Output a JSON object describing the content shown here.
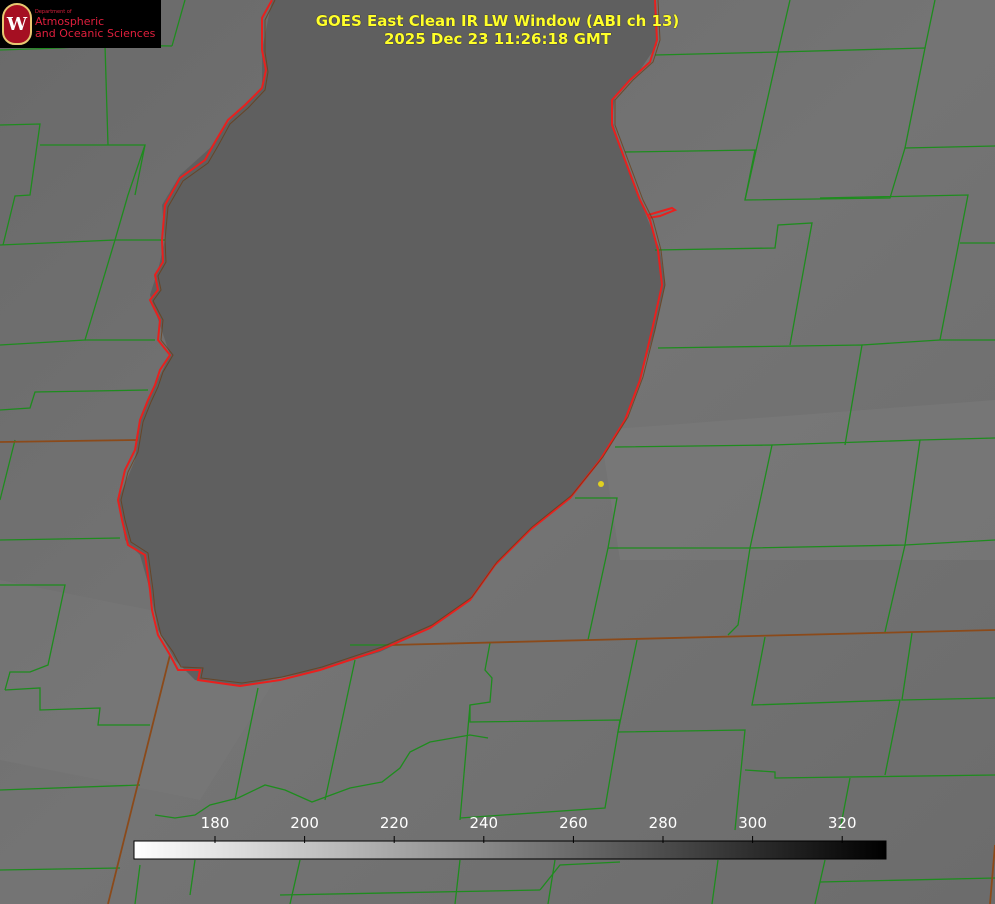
{
  "title": {
    "line1": "GOES East Clean IR LW Window (ABI ch 13)",
    "line2": "2025 Dec 23 11:26:18 GMT"
  },
  "logo": {
    "department": "Department of",
    "line1": "Atmospheric",
    "line2": "and Oceanic Sciences",
    "seal_letter": "W"
  },
  "colorbar": {
    "ticks": [
      "180",
      "200",
      "220",
      "240",
      "260",
      "280",
      "300",
      "320"
    ],
    "gradient_from": "#ffffff",
    "gradient_to": "#000000"
  },
  "colors": {
    "county_lines": "#1e8c1e",
    "state_lines": "#8b4a1a",
    "coastline": "#e8201e",
    "title": "#ffff2a",
    "marker": "#e0d020"
  }
}
